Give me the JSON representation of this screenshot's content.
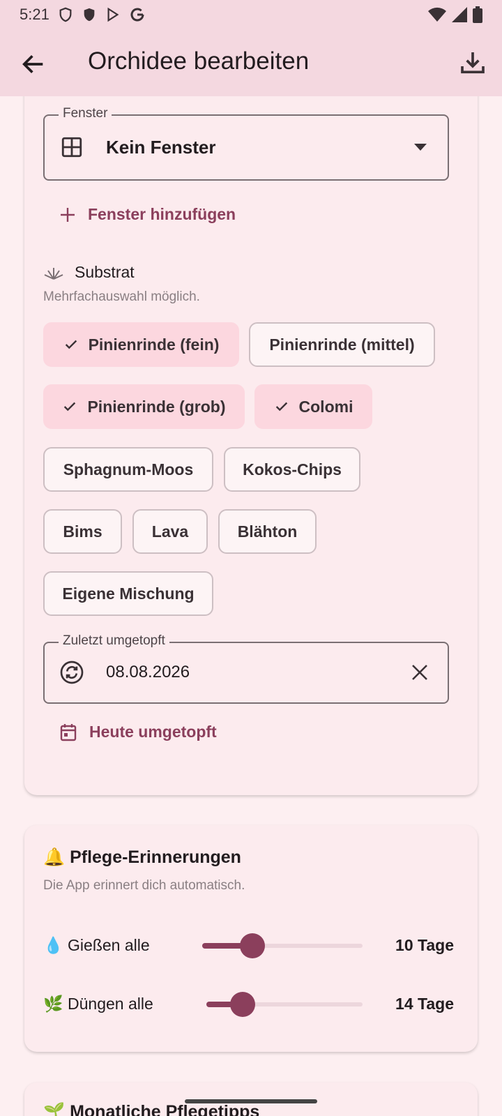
{
  "status": {
    "time": "5:21"
  },
  "appbar": {
    "title": "Orchidee bearbeiten",
    "back_icon": "arrow-left-icon",
    "save_icon": "download-icon"
  },
  "window_field": {
    "label": "Fenster",
    "value": "Kein Fenster",
    "icon": "window-icon"
  },
  "add_window_label": "Fenster hinzufügen",
  "substrate": {
    "title": "Substrat",
    "hint": "Mehrfachauswahl möglich.",
    "chips": [
      {
        "label": "Pinienrinde (fein)",
        "selected": true
      },
      {
        "label": "Pinienrinde (mittel)",
        "selected": false
      },
      {
        "label": "Pinienrinde (grob)",
        "selected": true
      },
      {
        "label": "Colomi",
        "selected": true
      },
      {
        "label": "Sphagnum-Moos",
        "selected": false
      },
      {
        "label": "Kokos-Chips",
        "selected": false
      },
      {
        "label": "Bims",
        "selected": false
      },
      {
        "label": "Lava",
        "selected": false
      },
      {
        "label": "Blähton",
        "selected": false
      },
      {
        "label": "Eigene Mischung",
        "selected": false
      }
    ]
  },
  "repot_field": {
    "label": "Zuletzt umgetopft",
    "value": "08.08.2026",
    "icon": "sync-icon"
  },
  "repot_today_label": "Heute umgetopft",
  "reminders": {
    "title": "🔔 Pflege-Erinnerungen",
    "hint": "Die App erinnert dich automatisch.",
    "water": {
      "label": "💧 Gießen alle",
      "value": "10 Tage",
      "fraction": 0.31
    },
    "fertilize": {
      "label": "🌿 Düngen alle",
      "value": "14 Tage",
      "fraction": 0.23
    }
  },
  "monthly_tips": {
    "title": "🌱 Monatliche Pflegetipps"
  },
  "colors": {
    "accent": "#8b3f5c",
    "chip_selected": "#fcd7df",
    "appbar": "#f4d8e0"
  }
}
